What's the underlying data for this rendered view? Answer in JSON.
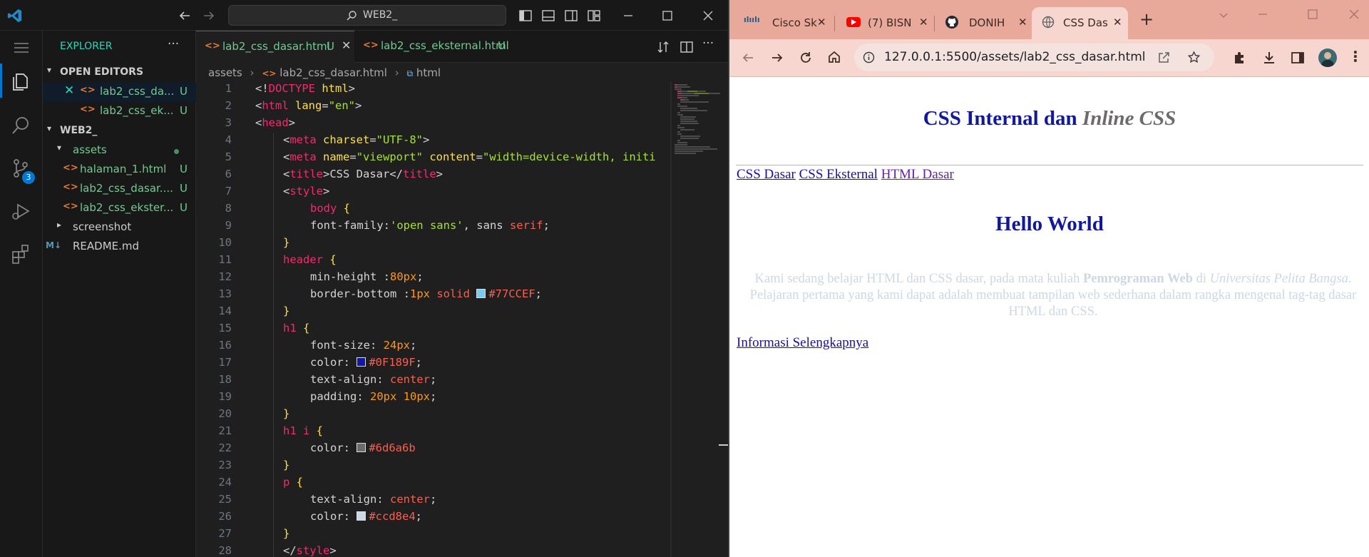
{
  "vscode": {
    "title_search": "WEB2_",
    "explorer_title": "EXPLORER",
    "open_editors_label": "OPEN EDITORS",
    "open_editors": [
      {
        "name": "lab2_css_da...",
        "status": "U"
      },
      {
        "name": "lab2_css_ek...",
        "status": "U"
      }
    ],
    "workspace_label": "WEB2_",
    "tree": {
      "assets": "assets",
      "files": [
        {
          "name": "halaman_1.html",
          "status": "U"
        },
        {
          "name": "lab2_css_dasar....",
          "status": "U"
        },
        {
          "name": "lab2_css_ekster...",
          "status": "U"
        }
      ],
      "screenshot": "screenshot",
      "readme": "README.md"
    },
    "scm_badge": "3",
    "tabs": [
      {
        "label": "lab2_css_dasar.html",
        "status": "U"
      },
      {
        "label": "lab2_css_eksternal.html",
        "status": "U"
      }
    ],
    "breadcrumb": {
      "folder": "assets",
      "file": "lab2_css_dasar.html",
      "symbol": "html"
    },
    "line_numbers": [
      "1",
      "2",
      "3",
      "4",
      "5",
      "6",
      "7",
      "8",
      "9",
      "10",
      "11",
      "12",
      "13",
      "14",
      "15",
      "16",
      "17",
      "18",
      "19",
      "20",
      "21",
      "22",
      "23",
      "24",
      "25",
      "26",
      "27",
      "28"
    ],
    "code": {
      "l1": {
        "a": "<!",
        "b": "DOCTYPE",
        "c": " html",
        "d": ">"
      },
      "l2": {
        "a": "<",
        "b": "html",
        "c": " lang",
        "d": "=",
        "e": "\"en\"",
        "f": ">"
      },
      "l3": {
        "a": "<",
        "b": "head",
        "c": ">"
      },
      "l4": {
        "a": "<",
        "b": "meta",
        "c": " charset",
        "d": "=",
        "e": "\"UTF-8\"",
        "f": ">"
      },
      "l5": {
        "a": "<",
        "b": "meta",
        "c": " name",
        "d": "=",
        "e": "\"viewport\"",
        "f": " content",
        "g": "=",
        "h": "\"width=device-width, initi"
      },
      "l6": {
        "a": "<",
        "b": "title",
        "c": ">CSS Dasar</",
        "d": "title",
        "e": ">"
      },
      "l7": {
        "a": "<",
        "b": "style",
        "c": ">"
      },
      "l8": {
        "a": "body",
        "b": " {"
      },
      "l9": {
        "a": "font-family:",
        "b": "'open sans'",
        "c": ", sans ",
        "d": "serif",
        "e": ";"
      },
      "l10": {
        "a": "}"
      },
      "l11": {
        "a": "header",
        "b": " {"
      },
      "l12": {
        "a": "min-height :",
        "b": "80px",
        "c": ";"
      },
      "l13": {
        "a": "border-bottom :",
        "b": "1px",
        "c": " solid ",
        "d": "#77CCEF",
        "e": ";",
        "swatch": "#77CCEF"
      },
      "l14": {
        "a": "}"
      },
      "l15": {
        "a": "h1",
        "b": " {"
      },
      "l16": {
        "a": "font-size: ",
        "b": "24px",
        "c": ";"
      },
      "l17": {
        "a": "color: ",
        "b": "#0F189F",
        "c": ";",
        "swatch": "#0F189F"
      },
      "l18": {
        "a": "text-align: ",
        "b": "center",
        "c": ";"
      },
      "l19": {
        "a": "padding: ",
        "b": "20px 10px",
        "c": ";"
      },
      "l20": {
        "a": "}"
      },
      "l21": {
        "a": "h1 i",
        "b": " {"
      },
      "l22": {
        "a": "color: ",
        "b": "#6d6a6b",
        "swatch": "#6d6a6b"
      },
      "l23": {
        "a": "}"
      },
      "l24": {
        "a": "p",
        "b": " {"
      },
      "l25": {
        "a": "text-align: ",
        "b": "center",
        "c": ";"
      },
      "l26": {
        "a": "color: ",
        "b": "#ccd8e4",
        "c": ";",
        "swatch": "#ccd8e4"
      },
      "l27": {
        "a": "}"
      },
      "l28": {
        "a": "</",
        "b": "style",
        "c": ">"
      }
    }
  },
  "browser": {
    "tabs": [
      {
        "label": "Cisco Sk"
      },
      {
        "label": "(7) BISN"
      },
      {
        "label": "DONIH"
      },
      {
        "label": "CSS Das"
      }
    ],
    "url": "127.0.0.1:5500/assets/lab2_css_dasar.html",
    "page": {
      "h1_main": "CSS Internal dan ",
      "h1_italic": "Inline CSS",
      "nav": [
        "CSS Dasar",
        "CSS Eksternal",
        "HTML Dasar"
      ],
      "h2": "Hello World",
      "p_1": "Kami sedang belajar HTML dan CSS dasar, pada mata kuliah ",
      "p_bold": "Pemrograman Web",
      "p_2": " di ",
      "p_italic": "Universitas Pelita Bangsa",
      "p_3": ". Pelajaran pertama yang kami dapat adalah membuat tampilan web sederhana dalam rangka mengenal tag-tag dasar HTML dan CSS.",
      "more_link": "Informasi Selengkapnya"
    },
    "colors": {
      "h1": "#0F189F",
      "h1_italic": "#6d6a6b",
      "p": "#ccd8e4",
      "border": "#77CCEF"
    }
  }
}
